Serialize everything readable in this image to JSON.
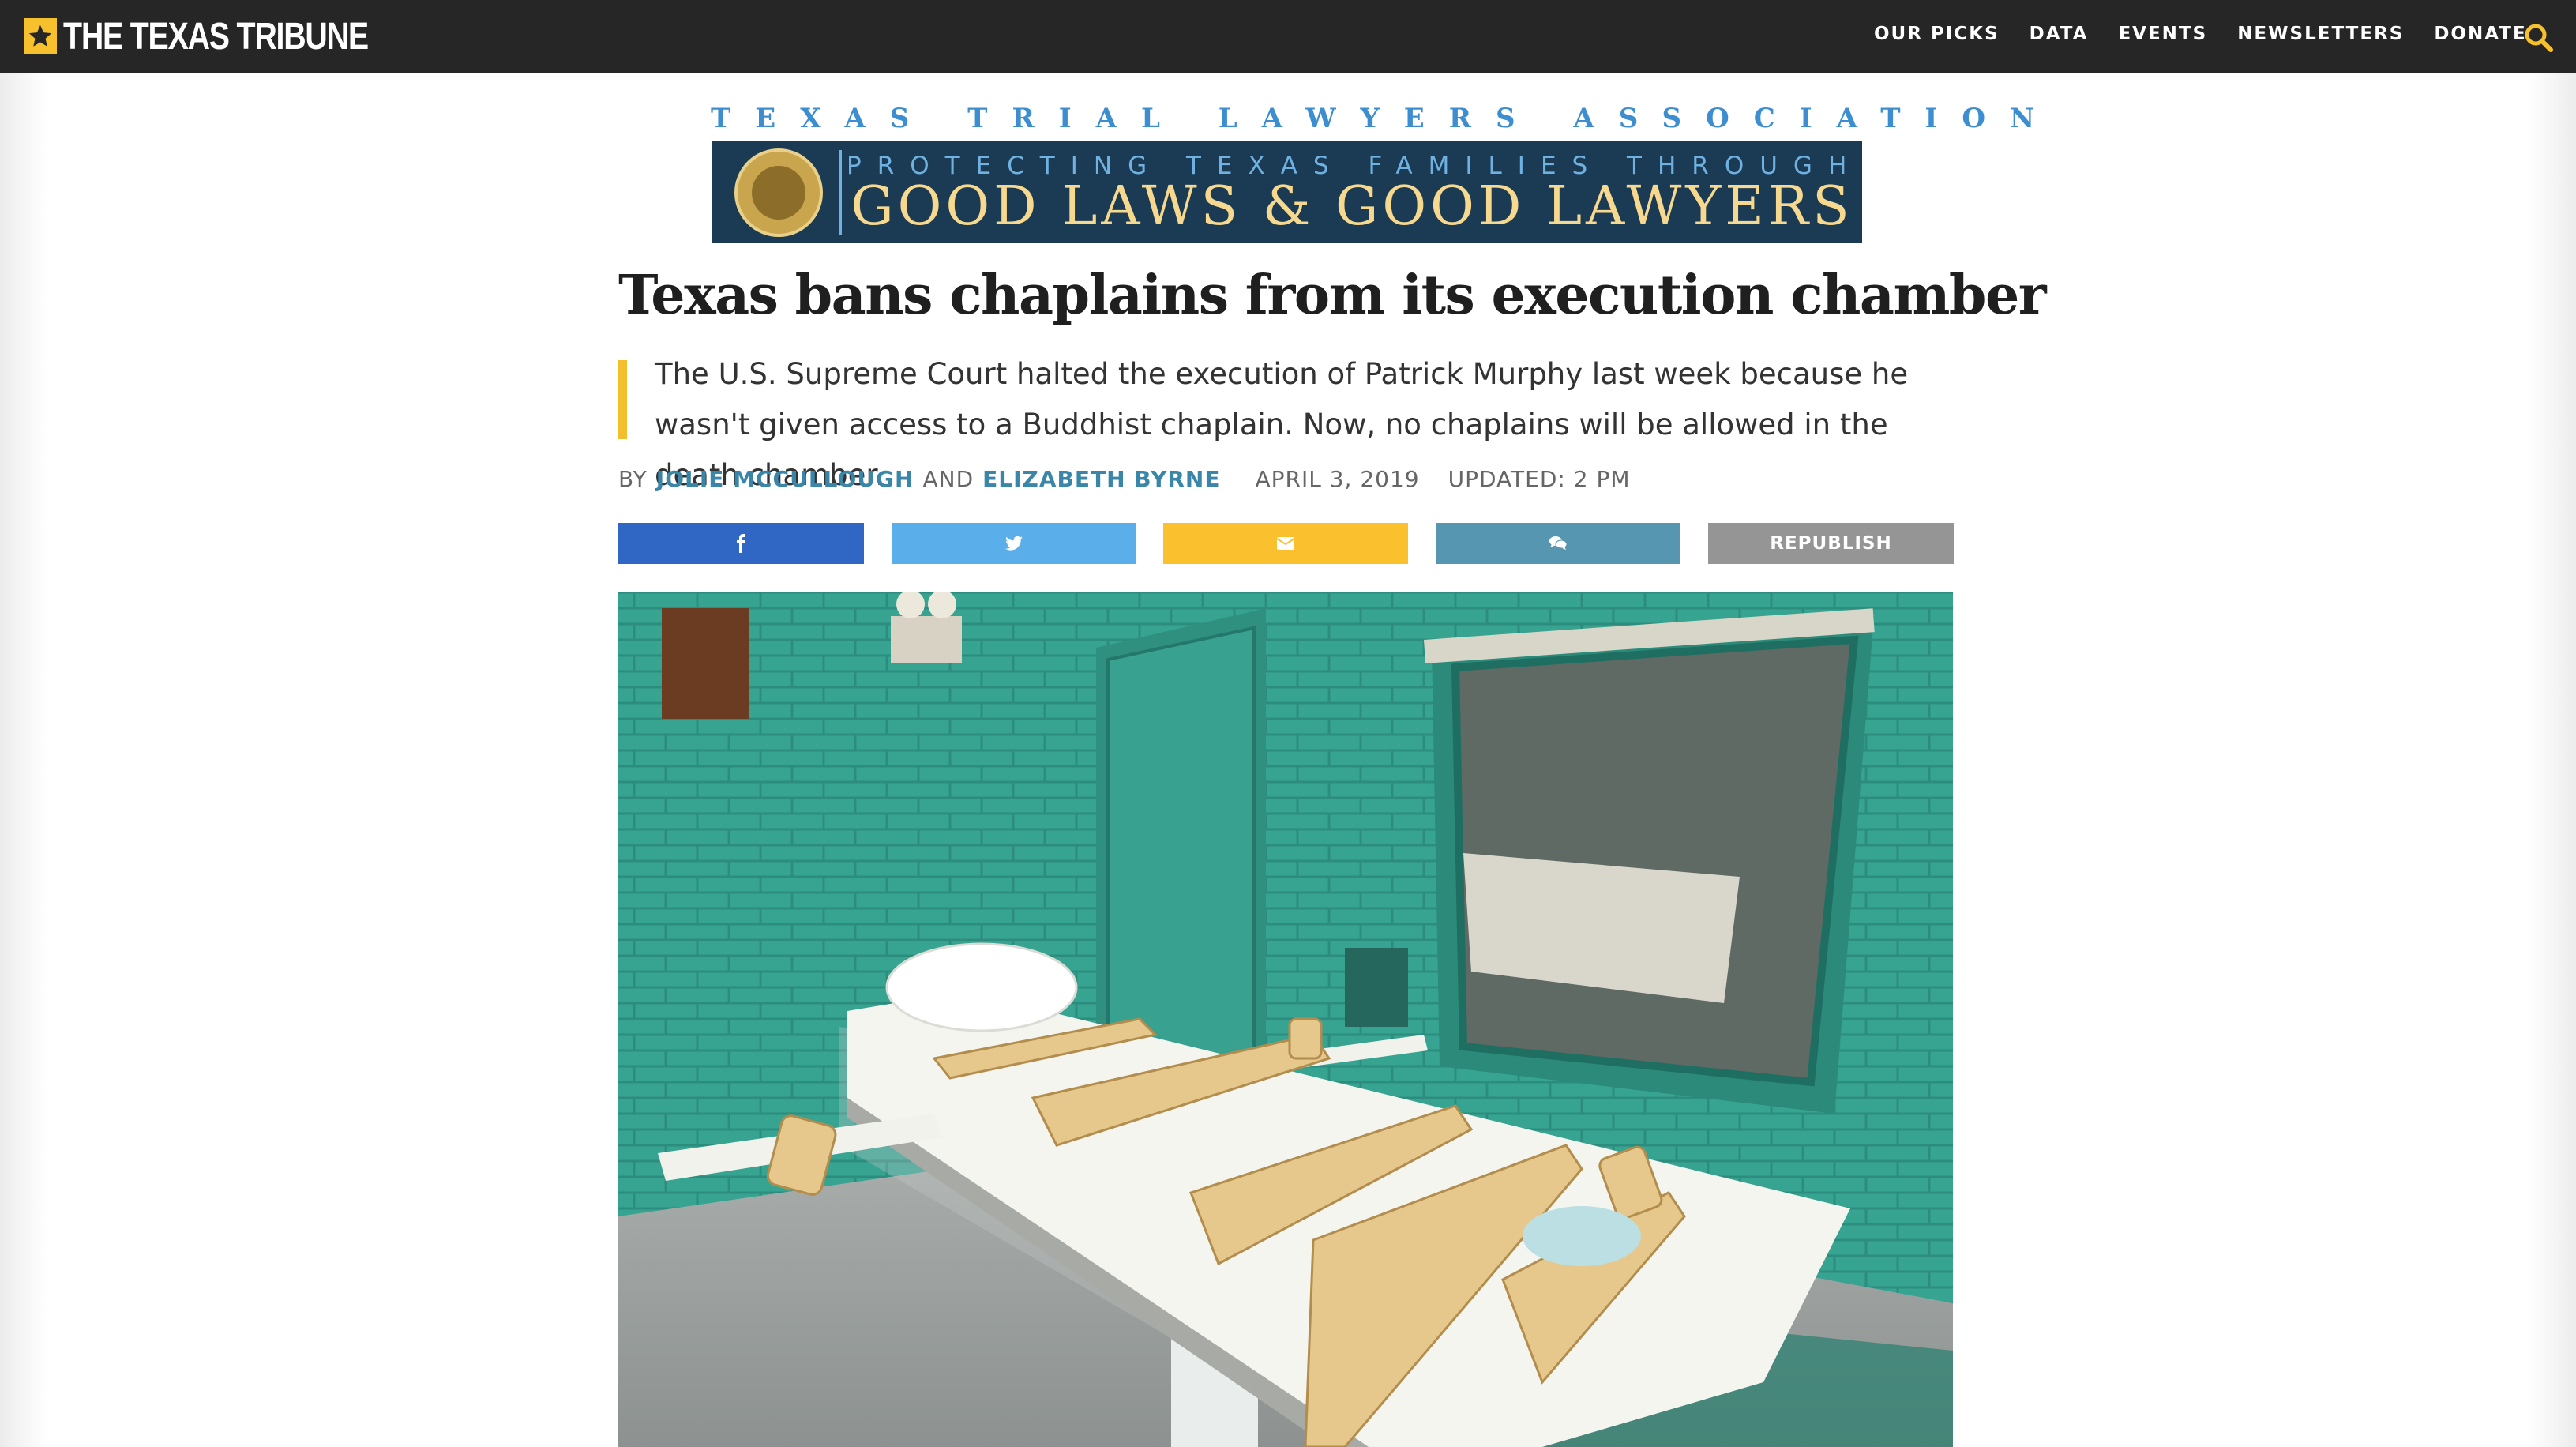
{
  "site": {
    "logo_text": "THE TEXAS TRIBUNE",
    "brand_color": "#f7c02d",
    "nav_items": [
      "OUR PICKS",
      "DATA",
      "EVENTS",
      "NEWSLETTERS",
      "DONATE"
    ]
  },
  "ad": {
    "org_name": "TEXAS TRIAL LAWYERS ASSOCIATION",
    "tagline": "PROTECTING TEXAS FAMILIES THROUGH",
    "slogan": "GOOD LAWS & GOOD LAWYERS"
  },
  "article": {
    "headline": "Texas bans chaplains from its execution chamber",
    "summary": "The U.S. Supreme Court halted the execution of Patrick Murphy last week because he wasn't given access to a Buddhist chaplain. Now, no chaplains will be allowed in the death chamber.",
    "byline_prefix": "BY",
    "author_1": "JOLIE MCCULLOUGH",
    "byline_conjunction": "AND",
    "author_2": "ELIZABETH BYRNE",
    "date": "APRIL 3, 2019",
    "updated": "UPDATED: 2 PM"
  },
  "share": {
    "facebook_icon": "facebook-icon",
    "twitter_icon": "twitter-icon",
    "email_icon": "envelope-icon",
    "comment_icon": "comments-icon",
    "republish_label": "REPUBLISH",
    "colors": {
      "facebook": "#3066c4",
      "twitter": "#5aaee9",
      "email": "#fbc02d",
      "comments": "#5696b1",
      "republish": "#959595"
    }
  },
  "photo": {
    "subject": "execution chamber gurney"
  }
}
